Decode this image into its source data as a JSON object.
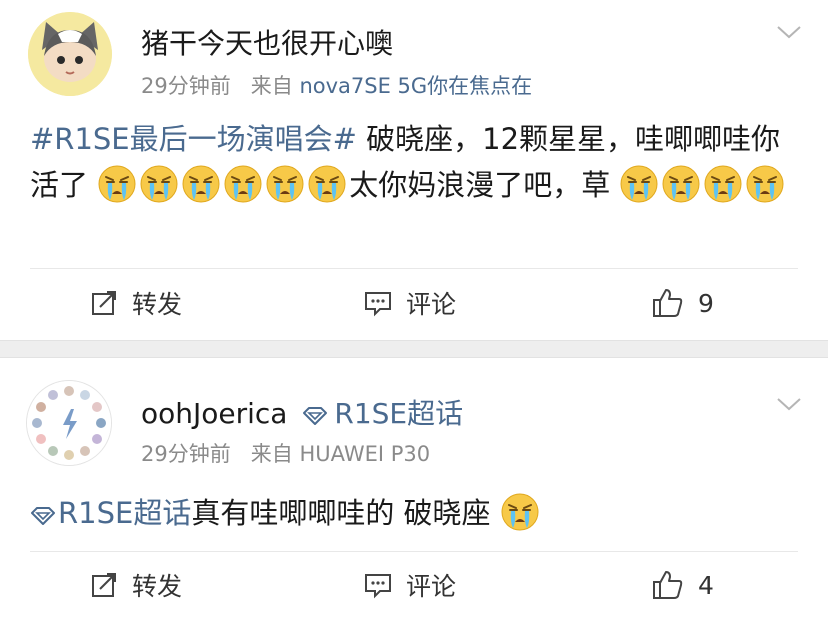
{
  "posts": [
    {
      "username": "猪干今天也很开心噢",
      "time": "29分钟前",
      "from_prefix": "来自",
      "source": "nova7SE 5G你在焦点在",
      "content": {
        "hashtag": "#R1SE最后一场演唱会#",
        "text1": " 破晓座，12颗星星，哇唧唧哇你活了",
        "text2": "太你妈浪漫了吧，草",
        "emoji": "crying-face"
      },
      "actions": {
        "repost": "转发",
        "comment": "评论",
        "likes": "9"
      }
    },
    {
      "username": "oohJoerica",
      "supertopic_badge": "R1SE超话",
      "time": "29分钟前",
      "from_prefix": "来自",
      "source": "HUAWEI P30",
      "content": {
        "supertopic": "R1SE超话",
        "text": "真有哇唧唧哇的 破晓座",
        "emoji": "crying-face"
      },
      "actions": {
        "repost": "转发",
        "comment": "评论",
        "likes": "4"
      }
    }
  ],
  "colors": {
    "link": "#4a6a8f",
    "meta": "#8a8a8a",
    "gap": "#eeeeee"
  }
}
